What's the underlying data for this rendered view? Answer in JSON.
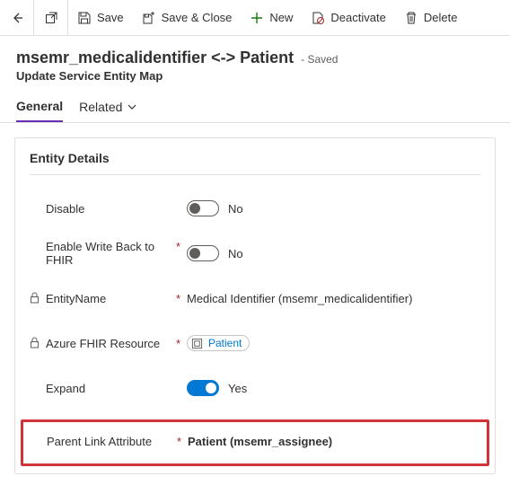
{
  "toolbar": {
    "save": "Save",
    "saveClose": "Save & Close",
    "new": "New",
    "deactivate": "Deactivate",
    "delete": "Delete"
  },
  "header": {
    "title": "msemr_medicalidentifier <-> Patient",
    "savedState": "- Saved",
    "subtitle": "Update Service Entity Map"
  },
  "tabs": {
    "general": "General",
    "related": "Related"
  },
  "card": {
    "title": "Entity Details",
    "fields": {
      "disable": {
        "label": "Disable",
        "value": "No"
      },
      "writeBack": {
        "label": "Enable Write Back to FHIR",
        "value": "No"
      },
      "entityName": {
        "label": "EntityName",
        "value": "Medical Identifier (msemr_medicalidentifier)"
      },
      "fhirResource": {
        "label": "Azure FHIR Resource",
        "value": "Patient"
      },
      "expand": {
        "label": "Expand",
        "value": "Yes"
      },
      "parentLink": {
        "label": "Parent Link Attribute",
        "value": "Patient (msemr_assignee)"
      }
    }
  }
}
